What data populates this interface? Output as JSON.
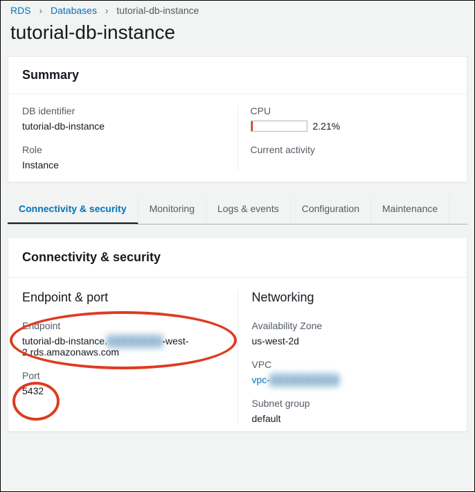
{
  "breadcrumbs": {
    "root": "RDS",
    "databases": "Databases",
    "current": "tutorial-db-instance"
  },
  "page_title": "tutorial-db-instance",
  "summary": {
    "title": "Summary",
    "db_identifier_label": "DB identifier",
    "db_identifier_value": "tutorial-db-instance",
    "role_label": "Role",
    "role_value": "Instance",
    "cpu_label": "CPU",
    "cpu_value": "2.21%",
    "current_activity_label": "Current activity"
  },
  "tabs": {
    "connectivity": "Connectivity & security",
    "monitoring": "Monitoring",
    "logs": "Logs & events",
    "configuration": "Configuration",
    "maintenance": "Maintenance"
  },
  "connectivity": {
    "title": "Connectivity & security",
    "endpoint_port_heading": "Endpoint & port",
    "endpoint_label": "Endpoint",
    "endpoint_value_pre": "tutorial-db-instance.",
    "endpoint_value_mid": "████████",
    "endpoint_value_post": "-west-2.rds.amazonaws.com",
    "port_label": "Port",
    "port_value": "5432",
    "networking_heading": "Networking",
    "az_label": "Availability Zone",
    "az_value": "us-west-2d",
    "vpc_label": "VPC",
    "vpc_value_pre": "vpc-",
    "vpc_value_blur": "██████████",
    "subnet_label": "Subnet group",
    "subnet_value": "default"
  }
}
